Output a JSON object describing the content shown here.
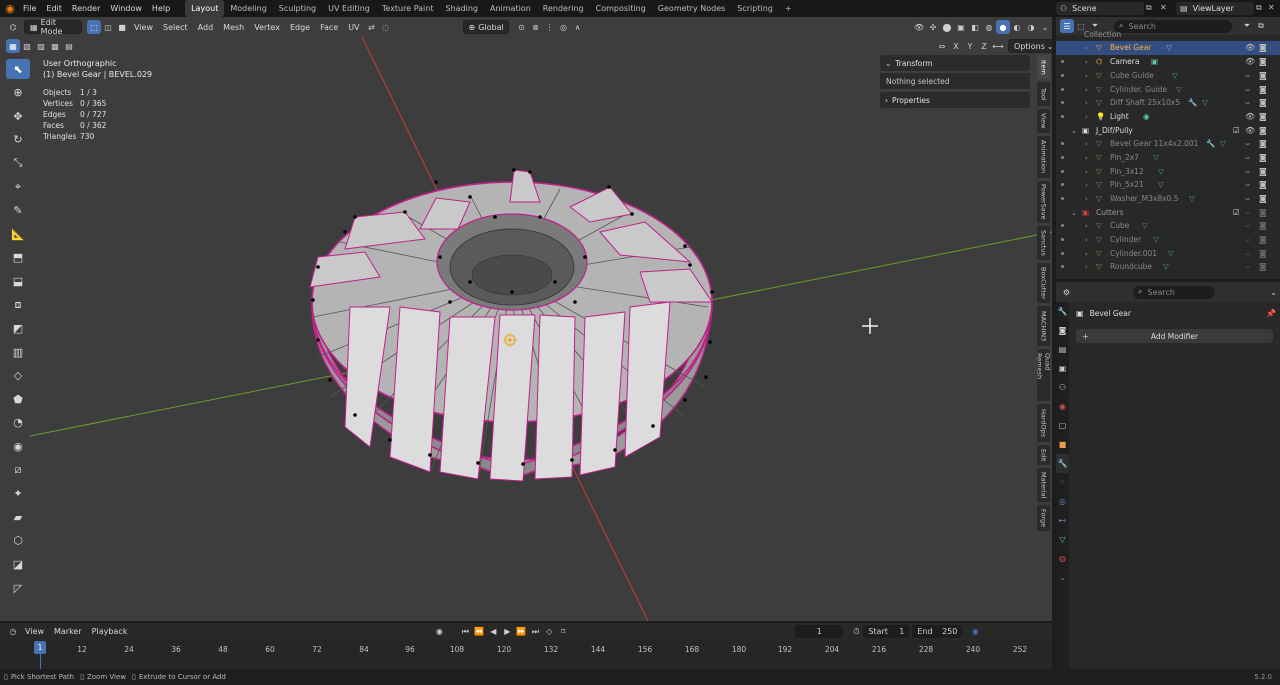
{
  "topbar": {
    "menus": [
      "File",
      "Edit",
      "Render",
      "Window",
      "Help"
    ],
    "workspaces": [
      "Layout",
      "Modeling",
      "Sculpting",
      "UV Editing",
      "Texture Paint",
      "Shading",
      "Animation",
      "Rendering",
      "Compositing",
      "Geometry Nodes",
      "Scripting"
    ],
    "active_workspace": "Layout",
    "add_workspace": "+",
    "scene": "Scene",
    "view_layer": "ViewLayer"
  },
  "viewport_header": {
    "mode": "Edit Mode",
    "menus": [
      "View",
      "Select",
      "Add",
      "Mesh",
      "Vertex",
      "Edge",
      "Face",
      "UV"
    ],
    "orientation": "Global",
    "axis_x": "X",
    "axis_y": "Y",
    "axis_z": "Z",
    "options": "Options"
  },
  "viewport_overlay": {
    "view_name": "User Orthographic",
    "object_name": "(1) Bevel Gear | BEVEL.029",
    "stats": [
      {
        "key": "Objects",
        "value": "1 / 3"
      },
      {
        "key": "Vertices",
        "value": "0 / 365"
      },
      {
        "key": "Edges",
        "value": "0 / 727"
      },
      {
        "key": "Faces",
        "value": "0 / 362"
      },
      {
        "key": "Triangles",
        "value": "730"
      }
    ]
  },
  "npanel": {
    "transform": "Transform",
    "nothing_selected": "Nothing selected",
    "properties": "Properties"
  },
  "side_tabs": [
    "Item",
    "Tool",
    "View",
    "Animation",
    "PowerSave",
    "Sanctus",
    "BoxCutter",
    "MACHIN3",
    "Quad Remesh",
    "HardOps",
    "Edit",
    "Material",
    "Forge"
  ],
  "outliner": {
    "search_placeholder": "Search",
    "top_clipped": "Collection",
    "rows": [
      {
        "label": "Bevel Gear",
        "selected": true,
        "indent": 1
      },
      {
        "label": "Camera",
        "selected": false,
        "indent": 1
      },
      {
        "label": "Cube Guide",
        "selected": false,
        "indent": 1,
        "dim": true
      },
      {
        "label": "Cylinder. Guide",
        "selected": false,
        "indent": 1,
        "dim": true
      },
      {
        "label": "Diff Shaft 25x10x5",
        "selected": false,
        "indent": 1,
        "dim": true
      },
      {
        "label": "Light",
        "selected": false,
        "indent": 1
      },
      {
        "label": "J_Dif/Pully",
        "selected": false,
        "indent": 0,
        "collection": true
      },
      {
        "label": "Bevel Gear 11x4x2.001",
        "selected": false,
        "indent": 1,
        "dim": true
      },
      {
        "label": "Pin_2x7",
        "selected": false,
        "indent": 1,
        "dim": true
      },
      {
        "label": "Pin_3x12",
        "selected": false,
        "indent": 1,
        "dim": true
      },
      {
        "label": "Pin_5x21",
        "selected": false,
        "indent": 1,
        "dim": true
      },
      {
        "label": "Washer_M3x8x0.5",
        "selected": false,
        "indent": 1,
        "dim": true
      },
      {
        "label": "Cutters",
        "selected": false,
        "indent": 0,
        "collection": true,
        "dim": true
      },
      {
        "label": "Cube",
        "selected": false,
        "indent": 1,
        "dim": true
      },
      {
        "label": "Cylinder",
        "selected": false,
        "indent": 1,
        "dim": true
      },
      {
        "label": "Cylinder.001",
        "selected": false,
        "indent": 1,
        "dim": true
      },
      {
        "label": "Roundcube",
        "selected": false,
        "indent": 1,
        "dim": true
      }
    ]
  },
  "properties": {
    "search_placeholder": "Search",
    "object_name": "Bevel Gear",
    "add_modifier": "Add Modifier"
  },
  "timeline": {
    "menus": [
      "View",
      "Marker",
      "Playback"
    ],
    "current_frame": "1",
    "start_label": "Start",
    "start_value": "1",
    "end_label": "End",
    "end_value": "250",
    "ruler_ticks": [
      "12",
      "24",
      "36",
      "48",
      "60",
      "72",
      "84",
      "96",
      "108",
      "120",
      "132",
      "144",
      "156",
      "168",
      "180",
      "192",
      "204",
      "216",
      "228",
      "240",
      "252"
    ],
    "playhead": "1"
  },
  "statusbar": {
    "items": [
      "Pick Shortest Path",
      "Zoom View",
      "Extrude to Cursor or Add"
    ],
    "version": "5.2.0"
  },
  "colors": {
    "accent": "#4772b3",
    "viewport_bg": "#3d3d3d",
    "edit_outline": "#c0208a",
    "x_axis": "#c83c3c",
    "y_axis": "#6e9a2a"
  }
}
